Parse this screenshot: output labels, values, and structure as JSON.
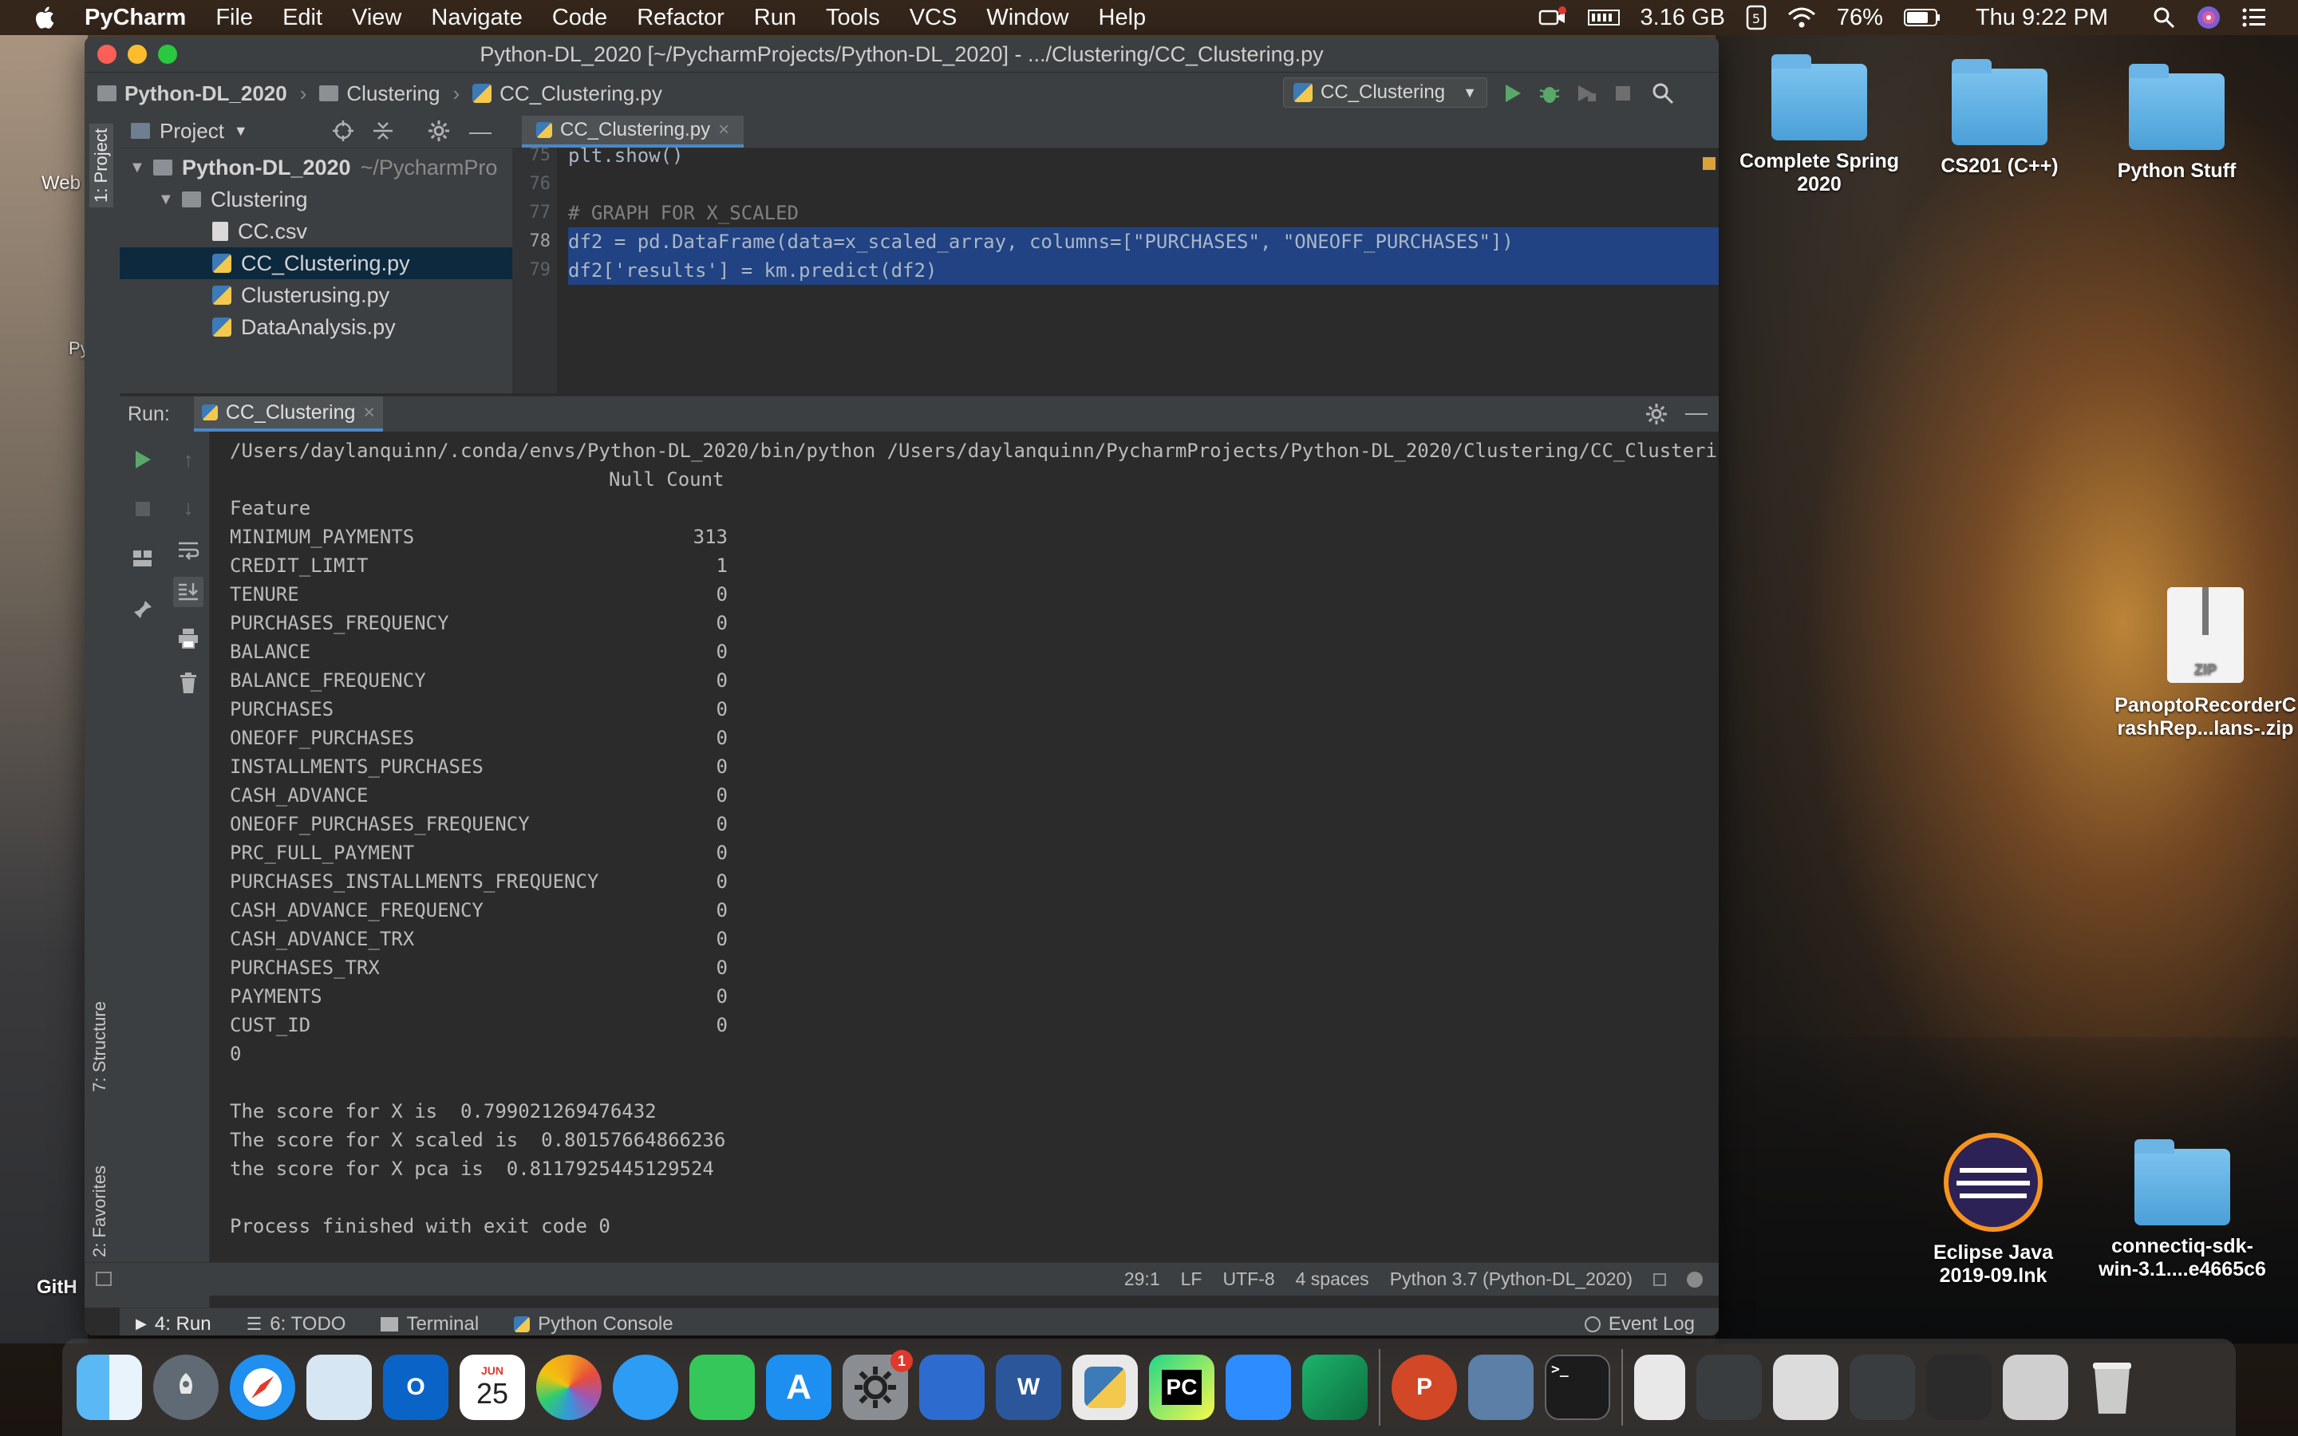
{
  "menubar": {
    "app_name": "PyCharm",
    "items": [
      "File",
      "Edit",
      "View",
      "Navigate",
      "Code",
      "Refactor",
      "Run",
      "Tools",
      "VCS",
      "Window",
      "Help"
    ],
    "memory": "3.16 GB",
    "battery": "76%",
    "clock": "Thu 9:22 PM"
  },
  "window": {
    "title": "Python-DL_2020 [~/PycharmProjects/Python-DL_2020] - .../Clustering/CC_Clustering.py"
  },
  "breadcrumb": [
    "Python-DL_2020",
    "Clustering",
    "CC_Clustering.py"
  ],
  "run_config": "CC_Clustering",
  "project_panel": {
    "title": "Project",
    "side_tab": "1: Project",
    "tree": [
      {
        "label": "Python-DL_2020",
        "suffix": "~/PycharmPro",
        "level": 0,
        "kind": "folder"
      },
      {
        "label": "Clustering",
        "suffix": "",
        "level": 1,
        "kind": "folder"
      },
      {
        "label": "CC.csv",
        "suffix": "",
        "level": 2,
        "kind": "file"
      },
      {
        "label": "CC_Clustering.py",
        "suffix": "",
        "level": 2,
        "kind": "py",
        "selected": true
      },
      {
        "label": "Clusterusing.py",
        "suffix": "",
        "level": 2,
        "kind": "py"
      },
      {
        "label": "DataAnalysis.py",
        "suffix": "",
        "level": 2,
        "kind": "py"
      }
    ]
  },
  "editor": {
    "tab": "CC_Clustering.py",
    "lines": [
      {
        "num": "75",
        "code": "plt.show()"
      },
      {
        "num": "76",
        "code": ""
      },
      {
        "num": "77",
        "code": "# GRAPH FOR X_SCALED"
      },
      {
        "num": "78",
        "code": "df2 = pd.DataFrame(data=x_scaled_array, columns=[\"PURCHASES\", \"ONEOFF_PURCHASES\"])"
      },
      {
        "num": "79",
        "code": "df2['results'] = km.predict(df2)"
      }
    ]
  },
  "run_panel": {
    "label": "Run:",
    "tab": "CC_Clustering",
    "command": "/Users/daylanquinn/.conda/envs/Python-DL_2020/bin/python /Users/daylanquinn/PycharmProjects/Python-DL_2020/Clustering/CC_Clustering.py",
    "table_header": "Null Count",
    "index_name": "Feature",
    "rows": [
      {
        "feature": "MINIMUM_PAYMENTS",
        "count": "313"
      },
      {
        "feature": "CREDIT_LIMIT",
        "count": "1"
      },
      {
        "feature": "TENURE",
        "count": "0"
      },
      {
        "feature": "PURCHASES_FREQUENCY",
        "count": "0"
      },
      {
        "feature": "BALANCE",
        "count": "0"
      },
      {
        "feature": "BALANCE_FREQUENCY",
        "count": "0"
      },
      {
        "feature": "PURCHASES",
        "count": "0"
      },
      {
        "feature": "ONEOFF_PURCHASES",
        "count": "0"
      },
      {
        "feature": "INSTALLMENTS_PURCHASES",
        "count": "0"
      },
      {
        "feature": "CASH_ADVANCE",
        "count": "0"
      },
      {
        "feature": "ONEOFF_PURCHASES_FREQUENCY",
        "count": "0"
      },
      {
        "feature": "PRC_FULL_PAYMENT",
        "count": "0"
      },
      {
        "feature": "PURCHASES_INSTALLMENTS_FREQUENCY",
        "count": "0"
      },
      {
        "feature": "CASH_ADVANCE_FREQUENCY",
        "count": "0"
      },
      {
        "feature": "CASH_ADVANCE_TRX",
        "count": "0"
      },
      {
        "feature": "PURCHASES_TRX",
        "count": "0"
      },
      {
        "feature": "PAYMENTS",
        "count": "0"
      },
      {
        "feature": "CUST_ID",
        "count": "0"
      }
    ],
    "zero_line": "0",
    "scores": [
      "The score for X is  0.799021269476432",
      "The score for X scaled is  0.80157664866236",
      "the score for X pca is  0.8117925445129524"
    ],
    "exit_line": "Process finished with exit code 0"
  },
  "side_tabs": {
    "structure": "7: Structure",
    "favorites": "2: Favorites"
  },
  "bottom_tabs": {
    "run": "4: Run",
    "todo": "6: TODO",
    "terminal": "Terminal",
    "python_console": "Python Console",
    "event_log": "Event Log"
  },
  "status_bar": {
    "position": "29:1",
    "line_sep": "LF",
    "encoding": "UTF-8",
    "indent": "4 spaces",
    "interpreter": "Python 3.7 (Python-DL_2020)"
  },
  "desktop_icons": [
    {
      "label": "Complete Spring 2020",
      "kind": "folder"
    },
    {
      "label": "CS201 (C++)",
      "kind": "folder"
    },
    {
      "label": "Python Stuff",
      "kind": "folder"
    },
    {
      "label": "PanoptoRecorderCrashRep...lans-.zip",
      "kind": "zip",
      "badge": "ZIP"
    },
    {
      "label": "Eclipse Java 2019-09.lnk",
      "kind": "eclipse"
    },
    {
      "label": "connectiq-sdk-win-3.1....e4665c6",
      "kind": "folder"
    }
  ],
  "desktop_fragments": {
    "web": "Web",
    "py": "Py",
    "github": "GitH"
  },
  "dock": {
    "calendar_month": "JUN",
    "calendar_day": "25",
    "pycharm_label": "PC",
    "word_label": "W",
    "powerpoint_label": "P",
    "outlook_label": "O",
    "settings_badge": "1",
    "terminal_label": ">_"
  }
}
